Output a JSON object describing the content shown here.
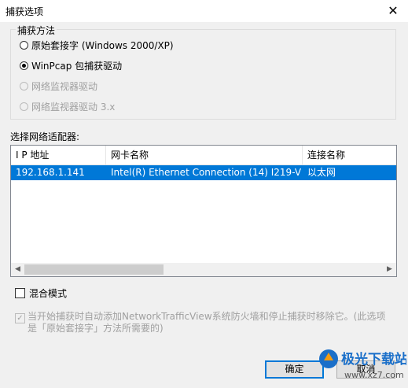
{
  "window": {
    "title": "捕获选项",
    "close_glyph": "✕"
  },
  "capture_method": {
    "legend": "捕获方法",
    "options": [
      {
        "label": "原始套接字 (Windows 2000/XP)",
        "checked": false,
        "enabled": true
      },
      {
        "label": "WinPcap 包捕获驱动",
        "checked": true,
        "enabled": true
      },
      {
        "label": "网络监视器驱动",
        "checked": false,
        "enabled": false
      },
      {
        "label": "网络监视器驱动 3.x",
        "checked": false,
        "enabled": false
      }
    ]
  },
  "adapters": {
    "label": "选择网络适配器:",
    "columns": [
      "I P 地址",
      "网卡名称",
      "连接名称"
    ],
    "rows": [
      {
        "ip": "192.168.1.141",
        "name": "Intel(R) Ethernet Connection (14) I219-V",
        "connection": "以太网",
        "selected": true
      }
    ],
    "scroll_left": "◀",
    "scroll_right": "▶"
  },
  "promiscuous": {
    "label": "混合模式",
    "checked": false
  },
  "firewall": {
    "label": "当开始捕获时自动添加NetworkTrafficView系统防火墙和停止捕获时移除它。(此选项是「原始套接字」方法所需要的)",
    "checked": true,
    "enabled": false,
    "check_glyph": "✓"
  },
  "buttons": {
    "ok": "确定",
    "cancel": "取消"
  },
  "watermark": {
    "text": "极光下载站",
    "url": "www.xz7.com"
  },
  "colors": {
    "selection": "#0078d7",
    "watermark_blue": "#1a6fc9",
    "watermark_orange": "#f39c12"
  }
}
